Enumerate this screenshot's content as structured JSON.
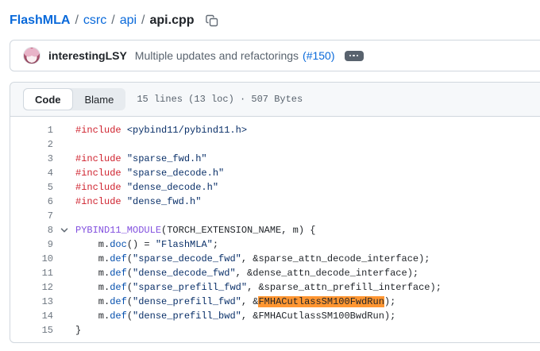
{
  "breadcrumb": {
    "repo": "FlashMLA",
    "separator": "/",
    "dirs": [
      "csrc",
      "api"
    ],
    "file": "api.cpp"
  },
  "commit": {
    "author": "interestingLSY",
    "message": "Multiple updates and refactorings",
    "pr_link": "(#150)"
  },
  "toolbar": {
    "tabs": [
      {
        "label": "Code",
        "active": true
      },
      {
        "label": "Blame",
        "active": false
      }
    ],
    "file_info": "15 lines (13 loc) · 507 Bytes"
  },
  "code": {
    "lines": [
      {
        "num": 1,
        "chevron": false,
        "tokens": [
          [
            "kw",
            "#include"
          ],
          [
            "pl",
            " "
          ],
          [
            "st",
            "<pybind11/pybind11.h>"
          ]
        ]
      },
      {
        "num": 2,
        "chevron": false,
        "tokens": []
      },
      {
        "num": 3,
        "chevron": false,
        "tokens": [
          [
            "kw",
            "#include"
          ],
          [
            "pl",
            " "
          ],
          [
            "st",
            "\"sparse_fwd.h\""
          ]
        ]
      },
      {
        "num": 4,
        "chevron": false,
        "tokens": [
          [
            "kw",
            "#include"
          ],
          [
            "pl",
            " "
          ],
          [
            "st",
            "\"sparse_decode.h\""
          ]
        ]
      },
      {
        "num": 5,
        "chevron": false,
        "tokens": [
          [
            "kw",
            "#include"
          ],
          [
            "pl",
            " "
          ],
          [
            "st",
            "\"dense_decode.h\""
          ]
        ]
      },
      {
        "num": 6,
        "chevron": false,
        "tokens": [
          [
            "kw",
            "#include"
          ],
          [
            "pl",
            " "
          ],
          [
            "st",
            "\"dense_fwd.h\""
          ]
        ]
      },
      {
        "num": 7,
        "chevron": false,
        "tokens": []
      },
      {
        "num": 8,
        "chevron": true,
        "tokens": [
          [
            "mc",
            "PYBIND11_MODULE"
          ],
          [
            "pl",
            "(TORCH_EXTENSION_NAME, m) {"
          ]
        ]
      },
      {
        "num": 9,
        "chevron": false,
        "tokens": [
          [
            "pl",
            "    m."
          ],
          [
            "fn",
            "doc"
          ],
          [
            "pl",
            "() = "
          ],
          [
            "st",
            "\"FlashMLA\""
          ],
          [
            "pl",
            ";"
          ]
        ]
      },
      {
        "num": 10,
        "chevron": false,
        "tokens": [
          [
            "pl",
            "    m."
          ],
          [
            "fn",
            "def"
          ],
          [
            "pl",
            "("
          ],
          [
            "st",
            "\"sparse_decode_fwd\""
          ],
          [
            "pl",
            ", &sparse_attn_decode_interface);"
          ]
        ]
      },
      {
        "num": 11,
        "chevron": false,
        "tokens": [
          [
            "pl",
            "    m."
          ],
          [
            "fn",
            "def"
          ],
          [
            "pl",
            "("
          ],
          [
            "st",
            "\"dense_decode_fwd\""
          ],
          [
            "pl",
            ", &dense_attn_decode_interface);"
          ]
        ]
      },
      {
        "num": 12,
        "chevron": false,
        "tokens": [
          [
            "pl",
            "    m."
          ],
          [
            "fn",
            "def"
          ],
          [
            "pl",
            "("
          ],
          [
            "st",
            "\"sparse_prefill_fwd\""
          ],
          [
            "pl",
            ", &sparse_attn_prefill_interface);"
          ]
        ]
      },
      {
        "num": 13,
        "chevron": false,
        "tokens": [
          [
            "pl",
            "    m."
          ],
          [
            "fn",
            "def"
          ],
          [
            "pl",
            "("
          ],
          [
            "st",
            "\"dense_prefill_fwd\""
          ],
          [
            "pl",
            ", &"
          ],
          [
            "hl",
            "FMHACutlassSM100FwdRun"
          ],
          [
            "pl",
            ");"
          ]
        ]
      },
      {
        "num": 14,
        "chevron": false,
        "tokens": [
          [
            "pl",
            "    m."
          ],
          [
            "fn",
            "def"
          ],
          [
            "pl",
            "("
          ],
          [
            "st",
            "\"dense_prefill_bwd\""
          ],
          [
            "pl",
            ", &FMHACutlassSM100BwdRun);"
          ]
        ]
      },
      {
        "num": 15,
        "chevron": false,
        "tokens": [
          [
            "pl",
            "}"
          ]
        ]
      }
    ]
  },
  "colors": {
    "link": "#0969da",
    "text": "#1f2328",
    "muted": "#59636e",
    "border": "#d0d7de",
    "toolbar_bg": "#f6f8fa",
    "keyword_red": "#cf222e",
    "string_blue": "#0a3069",
    "function_blue": "#0550ae",
    "macro_purple": "#8250df",
    "match_highlight": "#ff9632"
  }
}
